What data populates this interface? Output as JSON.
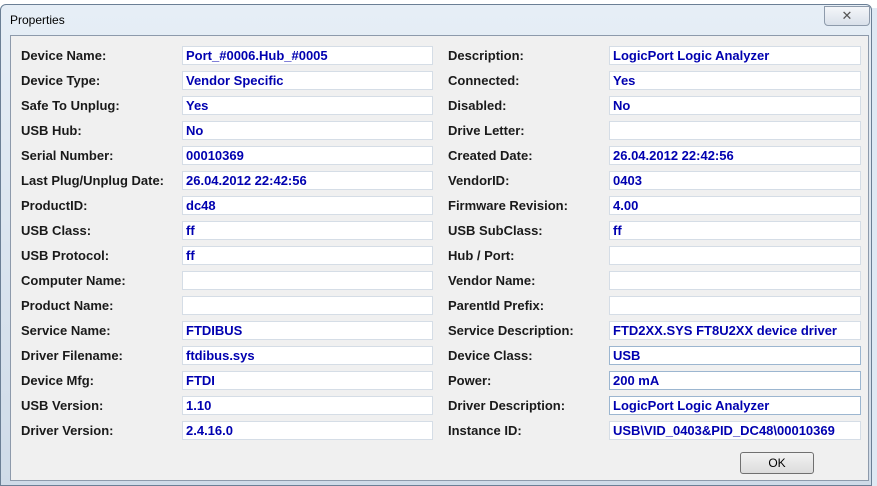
{
  "window": {
    "title": "Properties",
    "close_icon": "close-icon",
    "ok_label": "OK"
  },
  "left": [
    {
      "label": "Device Name:",
      "value": "Port_#0006.Hub_#0005"
    },
    {
      "label": "Device Type:",
      "value": "Vendor Specific"
    },
    {
      "label": "Safe To Unplug:",
      "value": "Yes"
    },
    {
      "label": "USB Hub:",
      "value": "No"
    },
    {
      "label": "Serial Number:",
      "value": "00010369"
    },
    {
      "label": "Last Plug/Unplug Date:",
      "value": "26.04.2012 22:42:56"
    },
    {
      "label": "ProductID:",
      "value": "dc48"
    },
    {
      "label": "USB Class:",
      "value": "ff"
    },
    {
      "label": "USB Protocol:",
      "value": "ff"
    },
    {
      "label": "Computer Name:",
      "value": ""
    },
    {
      "label": "Product Name:",
      "value": ""
    },
    {
      "label": "Service Name:",
      "value": "FTDIBUS"
    },
    {
      "label": "Driver Filename:",
      "value": "ftdibus.sys"
    },
    {
      "label": "Device Mfg:",
      "value": "FTDI"
    },
    {
      "label": "USB Version:",
      "value": "1.10"
    },
    {
      "label": "Driver Version:",
      "value": "2.4.16.0"
    }
  ],
  "right": [
    {
      "label": "Description:",
      "value": "LogicPort Logic Analyzer"
    },
    {
      "label": "Connected:",
      "value": "Yes"
    },
    {
      "label": "Disabled:",
      "value": "No"
    },
    {
      "label": "Drive Letter:",
      "value": ""
    },
    {
      "label": "Created Date:",
      "value": "26.04.2012 22:42:56"
    },
    {
      "label": "VendorID:",
      "value": "0403"
    },
    {
      "label": "Firmware Revision:",
      "value": "4.00"
    },
    {
      "label": "USB SubClass:",
      "value": "ff"
    },
    {
      "label": "Hub / Port:",
      "value": ""
    },
    {
      "label": "Vendor Name:",
      "value": ""
    },
    {
      "label": "ParentId Prefix:",
      "value": ""
    },
    {
      "label": "Service Description:",
      "value": "FTD2XX.SYS FT8U2XX device driver"
    },
    {
      "label": "Device Class:",
      "value": "USB"
    },
    {
      "label": "Power:",
      "value": "200 mA"
    },
    {
      "label": "Driver Description:",
      "value": "LogicPort Logic Analyzer"
    },
    {
      "label": "Instance ID:",
      "value": "USB\\VID_0403&PID_DC48\\00010369"
    }
  ]
}
